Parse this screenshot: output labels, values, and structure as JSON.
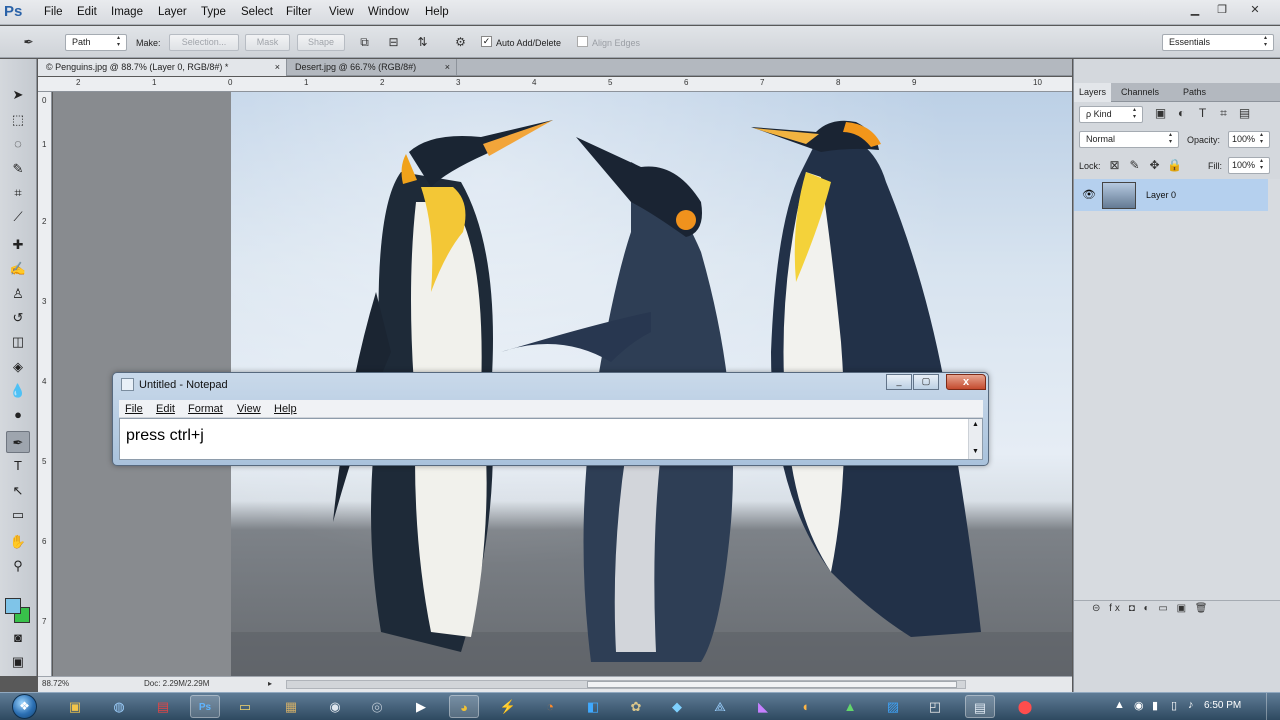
{
  "app": {
    "logo": "Ps"
  },
  "menu": [
    "File",
    "Edit",
    "Image",
    "Layer",
    "Type",
    "Select",
    "Filter",
    "View",
    "Window",
    "Help"
  ],
  "options": {
    "mode": "Path",
    "make_label": "Make:",
    "selection": "Selection...",
    "mask": "Mask",
    "shape": "Shape",
    "auto_add": "Auto Add/Delete",
    "align_edges": "Align Edges",
    "workspace": "Essentials",
    "auto_add_checked": "✓"
  },
  "tabs": [
    {
      "label": "© Penguins.jpg @ 88.7% (Layer 0, RGB/8#) *",
      "close": "×"
    },
    {
      "label": "Desert.jpg @ 66.7% (RGB/8#)",
      "close": "×"
    }
  ],
  "ruler": {
    "h": [
      "2",
      "1",
      "0",
      "1",
      "2",
      "3",
      "4",
      "5",
      "6",
      "7",
      "8",
      "9",
      "10"
    ],
    "v": [
      "0",
      "1",
      "2",
      "3",
      "4",
      "5",
      "6",
      "7"
    ]
  },
  "status": {
    "zoom": "88.72%",
    "doc": "Doc: 2.29M/2.29M",
    "arrow": "▸"
  },
  "panels": {
    "tabs": [
      "Layers",
      "Channels",
      "Paths"
    ],
    "kind": "ρ Kind",
    "blend": "Normal",
    "opacity_label": "Opacity:",
    "opacity": "100%",
    "lock_label": "Lock:",
    "fill_label": "Fill:",
    "fill": "100%",
    "layer_name": "Layer 0",
    "bottom_icons": "⊝  fx  ◘  ◐  ▭  ▣  🗑"
  },
  "notepad": {
    "title": "Untitled - Notepad",
    "menu": [
      "File",
      "Edit",
      "Format",
      "View",
      "Help"
    ],
    "text": "press ctrl+j",
    "min": "_",
    "max": "▢",
    "close": "x"
  },
  "taskbar": {
    "start": "❖",
    "clock": "6:50 PM"
  },
  "colors": {
    "accent": "#2a62a8",
    "foreground_swatch": "#7fc4e8",
    "background_swatch": "#38c14a"
  }
}
